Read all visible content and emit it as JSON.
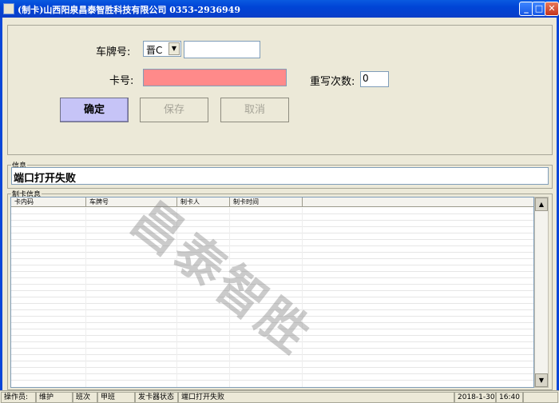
{
  "window": {
    "title": "(制卡)山西阳泉昌泰智胜科技有限公司  0353-2936949",
    "minimize": "_",
    "maximize": "□",
    "close": "✕"
  },
  "form": {
    "plate_label": "车牌号:",
    "plate_prefix": "晋C",
    "plate_value": "",
    "card_label": "卡号:",
    "card_value": "",
    "rewrite_label": "重写次数:",
    "rewrite_value": "0",
    "ok_button": "确定",
    "save_button": "保存",
    "cancel_button": "取消"
  },
  "info": {
    "group_title": "信息",
    "message": "端口打开失败"
  },
  "card_info": {
    "group_title": "制卡信息",
    "columns": [
      "卡内码",
      "车牌号",
      "制卡人",
      "制卡时间"
    ]
  },
  "watermark": "昌泰智胜",
  "statusbar": {
    "operator_label": "操作员:",
    "operator": "维护",
    "shift_label": "班次",
    "shift": "甲班",
    "reader_label": "发卡器状态",
    "reader_status": "端口打开失败",
    "date": "2018-1-30",
    "time": "16:40"
  },
  "colors": {
    "titlebar": "#0a46d8",
    "card_field": "#ff8a8a",
    "ok_button": "#c6c4f7"
  }
}
